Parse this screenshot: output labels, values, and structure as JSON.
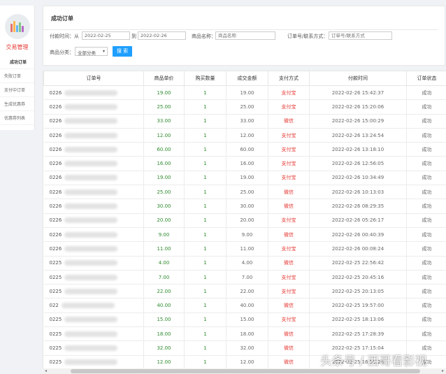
{
  "sidebar": {
    "title": "交易管理",
    "items": [
      {
        "label": "成功订单",
        "active": true
      },
      {
        "label": "失败订单",
        "active": false
      },
      {
        "label": "支付中订单",
        "active": false
      },
      {
        "label": "生成优惠券",
        "active": false
      },
      {
        "label": "优惠券列表",
        "active": false
      }
    ],
    "logo_colors": [
      "#e57373",
      "#ffb74d",
      "#64b5f6",
      "#81c784",
      "#ba68c8"
    ]
  },
  "search": {
    "title": "成功订单",
    "pay_time_label": "付款时间：从",
    "date_from": "2022-02-25",
    "to_label": "到",
    "date_to": "2022-02-26",
    "product_label": "商品名称：",
    "product_placeholder": "商品名称",
    "order_label": "订单号/联系方式：",
    "order_placeholder": "订单号/联系方式",
    "category_label": "商品分类：",
    "category_value": "全部分类",
    "search_button": "搜 索"
  },
  "table": {
    "headers": [
      "订单号",
      "商品单价",
      "购买数量",
      "成交金额",
      "支付方式",
      "付款时间",
      "订单状态"
    ],
    "rows": [
      {
        "order": "0226",
        "price": "19.00",
        "qty": "1",
        "amount": "19.00",
        "pay": "支付宝",
        "time": "2022-02-26 15:42:37",
        "status": "成功"
      },
      {
        "order": "0226",
        "price": "25.00",
        "qty": "1",
        "amount": "25.00",
        "pay": "支付宝",
        "time": "2022-02-26 15:20:06",
        "status": "成功"
      },
      {
        "order": "0226",
        "price": "33.00",
        "qty": "1",
        "amount": "33.00",
        "pay": "微信",
        "time": "2022-02-26 15:00:29",
        "status": "成功"
      },
      {
        "order": "0226",
        "price": "12.00",
        "qty": "1",
        "amount": "12.00",
        "pay": "支付宝",
        "time": "2022-02-26 13:24:54",
        "status": "成功"
      },
      {
        "order": "0226",
        "price": "60.00",
        "qty": "1",
        "amount": "60.00",
        "pay": "支付宝",
        "time": "2022-02-26 13:18:10",
        "status": "成功"
      },
      {
        "order": "0226",
        "price": "16.00",
        "qty": "1",
        "amount": "16.00",
        "pay": "支付宝",
        "time": "2022-02-26 12:56:05",
        "status": "成功"
      },
      {
        "order": "0226",
        "price": "19.00",
        "qty": "1",
        "amount": "19.00",
        "pay": "支付宝",
        "time": "2022-02-26 10:34:49",
        "status": "成功"
      },
      {
        "order": "0226",
        "price": "25.00",
        "qty": "1",
        "amount": "25.00",
        "pay": "微信",
        "time": "2022-02-26 10:13:03",
        "status": "成功"
      },
      {
        "order": "0226",
        "price": "30.00",
        "qty": "1",
        "amount": "30.00",
        "pay": "微信",
        "time": "2022-02-26 08:29:35",
        "status": "成功"
      },
      {
        "order": "0226",
        "price": "20.00",
        "qty": "1",
        "amount": "20.00",
        "pay": "支付宝",
        "time": "2022-02-26 05:26:17",
        "status": "成功"
      },
      {
        "order": "0226",
        "price": "9.00",
        "qty": "1",
        "amount": "9.00",
        "pay": "微信",
        "time": "2022-02-26 00:40:39",
        "status": "成功"
      },
      {
        "order": "0226",
        "price": "11.00",
        "qty": "1",
        "amount": "11.00",
        "pay": "支付宝",
        "time": "2022-02-26 00:08:24",
        "status": "成功"
      },
      {
        "order": "0225",
        "price": "4.00",
        "qty": "1",
        "amount": "4.00",
        "pay": "微信",
        "time": "2022-02-25 22:56:42",
        "status": "成功"
      },
      {
        "order": "0225",
        "price": "7.00",
        "qty": "1",
        "amount": "7.00",
        "pay": "支付宝",
        "time": "2022-02-25 20:45:16",
        "status": "成功"
      },
      {
        "order": "0225",
        "price": "22.00",
        "qty": "1",
        "amount": "22.00",
        "pay": "支付宝",
        "time": "2022-02-25 20:13:05",
        "status": "成功"
      },
      {
        "order": "022",
        "price": "40.00",
        "qty": "1",
        "amount": "40.00",
        "pay": "微信",
        "time": "2022-02-25 19:57:00",
        "status": "成功"
      },
      {
        "order": "0225",
        "price": "15.00",
        "qty": "1",
        "amount": "15.00",
        "pay": "支付宝",
        "time": "2022-02-25 18:13:06",
        "status": "成功"
      },
      {
        "order": "0225",
        "price": "18.00",
        "qty": "1",
        "amount": "18.00",
        "pay": "微信",
        "time": "2022-02-25 17:28:39",
        "status": "成功"
      },
      {
        "order": "0225",
        "price": "32.00",
        "qty": "1",
        "amount": "32.00",
        "pay": "微信",
        "time": "2022-02-25 17:15:04",
        "status": "成功"
      },
      {
        "order": "0225",
        "price": "12.00",
        "qty": "1",
        "amount": "12.00",
        "pay": "微信",
        "time": "2022-02-25 16:55:28",
        "status": "成功"
      }
    ]
  },
  "watermark": "头条号 / 西哥看影视",
  "colors": {
    "price": "#2e8b2e",
    "pay": "#e53935",
    "button": "#1e9fff",
    "accent": "#e53935"
  }
}
